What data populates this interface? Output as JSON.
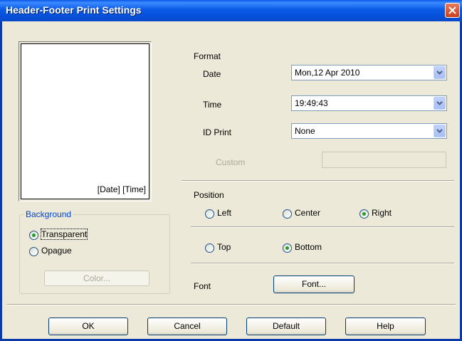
{
  "window": {
    "title": "Header-Footer Print Settings"
  },
  "preview": {
    "caption": "[Date] [Time]"
  },
  "background": {
    "legend": "Background",
    "transparent_label": "Transparent",
    "opaque_label": "Opague",
    "selected": "Transparent",
    "color_button": "Color..."
  },
  "format": {
    "heading": "Format",
    "date_label": "Date",
    "date_value": "Mon,12 Apr 2010",
    "time_label": "Time",
    "time_value": "19:49:43",
    "id_print_label": "ID Print",
    "id_print_value": "None",
    "custom_label": "Custom",
    "custom_value": ""
  },
  "position": {
    "heading": "Position",
    "left_label": "Left",
    "center_label": "Center",
    "right_label": "Right",
    "horizontal_selected": "Right",
    "top_label": "Top",
    "bottom_label": "Bottom",
    "vertical_selected": "Bottom"
  },
  "font": {
    "label": "Font",
    "button": "Font..."
  },
  "buttons": {
    "ok": "OK",
    "cancel": "Cancel",
    "default": "Default",
    "help": "Help"
  }
}
